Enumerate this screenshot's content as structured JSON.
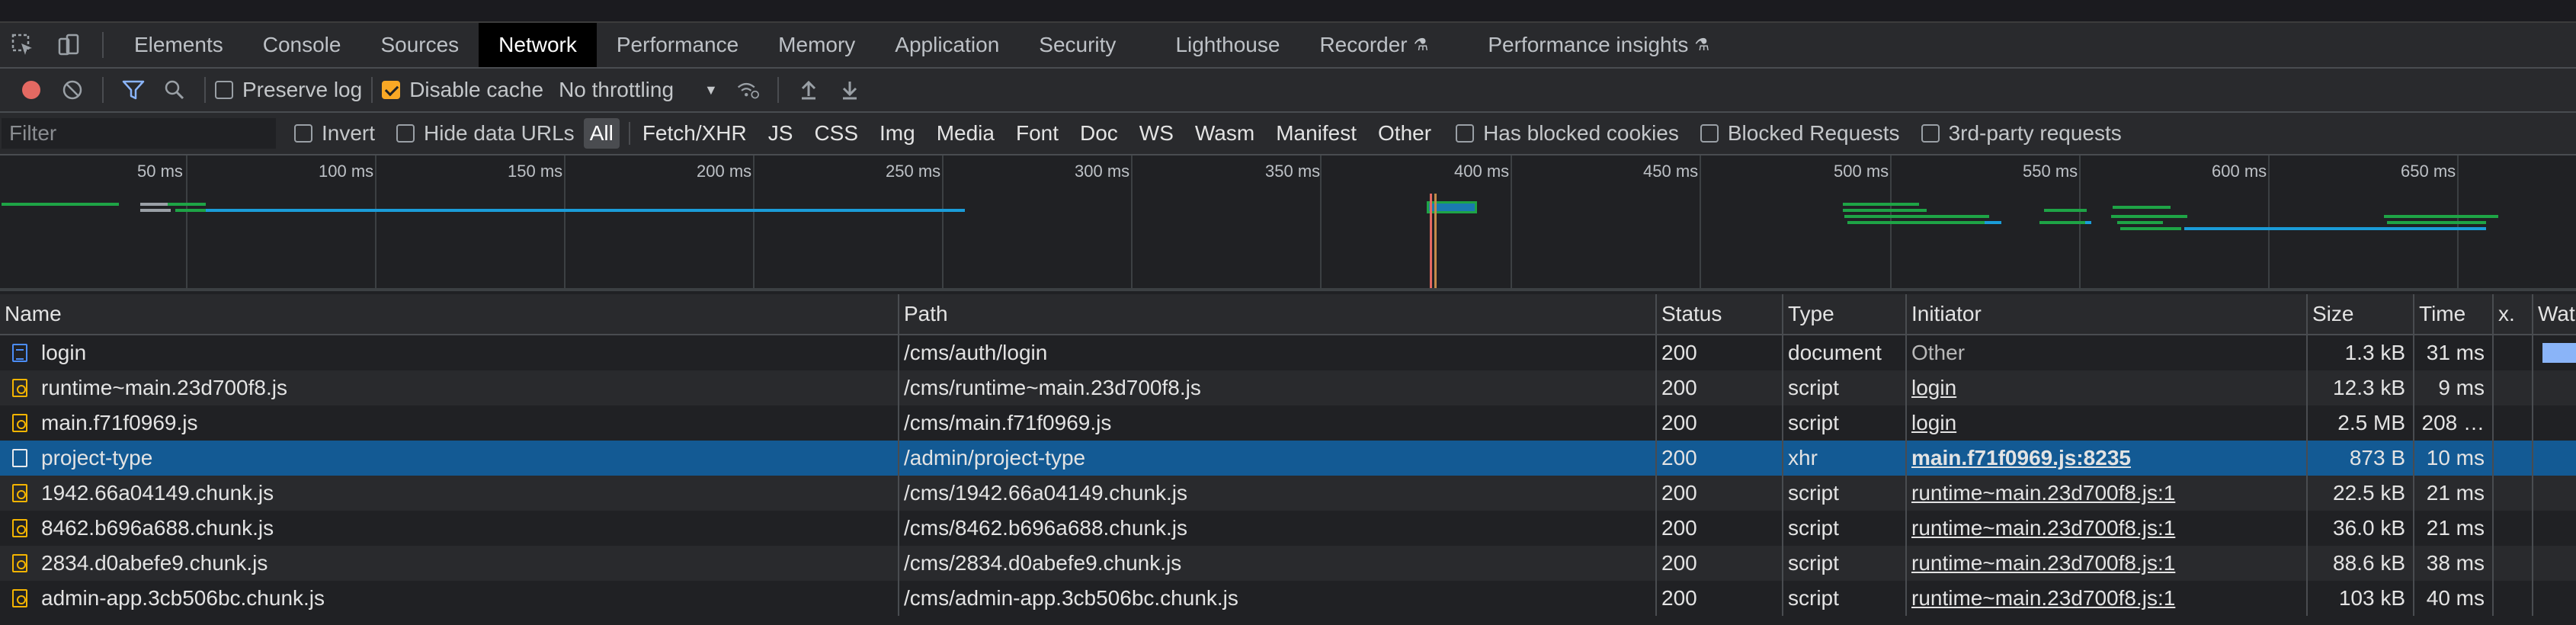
{
  "tabs": [
    {
      "label": "Elements"
    },
    {
      "label": "Console"
    },
    {
      "label": "Sources"
    },
    {
      "label": "Network",
      "active": true
    },
    {
      "label": "Performance"
    },
    {
      "label": "Memory"
    },
    {
      "label": "Application"
    },
    {
      "label": "Security"
    },
    {
      "label": "Lighthouse"
    },
    {
      "label": "Recorder"
    },
    {
      "label": "Performance insights"
    }
  ],
  "toolbar": {
    "preserve_log": "Preserve log",
    "preserve_log_checked": false,
    "disable_cache": "Disable cache",
    "disable_cache_checked": true,
    "throttling": "No throttling"
  },
  "filter": {
    "placeholder": "Filter",
    "invert": "Invert",
    "hide_data_urls": "Hide data URLs",
    "types": [
      "All",
      "Fetch/XHR",
      "JS",
      "CSS",
      "Img",
      "Media",
      "Font",
      "Doc",
      "WS",
      "Wasm",
      "Manifest",
      "Other"
    ],
    "active_type": "All",
    "has_blocked_cookies": "Has blocked cookies",
    "blocked_requests": "Blocked Requests",
    "third_party": "3rd-party requests"
  },
  "overview": {
    "ticks": [
      "50 ms",
      "100 ms",
      "150 ms",
      "200 ms",
      "250 ms",
      "300 ms",
      "350 ms",
      "400 ms",
      "450 ms",
      "500 ms",
      "550 ms",
      "600 ms",
      "650 ms"
    ]
  },
  "table": {
    "columns": {
      "name": "Name",
      "path": "Path",
      "status": "Status",
      "type": "Type",
      "initiator": "Initiator",
      "size": "Size",
      "time": "Time",
      "x": "x.",
      "waterfall": "Wate"
    },
    "rows": [
      {
        "name": "login",
        "icon": "document-icon",
        "path": "/cms/auth/login",
        "status": "200",
        "type": "document",
        "initiator": "Other",
        "initiator_link": false,
        "size": "1.3 kB",
        "time": "31 ms"
      },
      {
        "name": "runtime~main.23d700f8.js",
        "icon": "script-icon",
        "path": "/cms/runtime~main.23d700f8.js",
        "status": "200",
        "type": "script",
        "initiator": "login",
        "initiator_link": true,
        "size": "12.3 kB",
        "time": "9 ms"
      },
      {
        "name": "main.f71f0969.js",
        "icon": "script-icon",
        "path": "/cms/main.f71f0969.js",
        "status": "200",
        "type": "script",
        "initiator": "login",
        "initiator_link": true,
        "size": "2.5 MB",
        "time": "208 …"
      },
      {
        "name": "project-type",
        "icon": "xhr-icon",
        "path": "/admin/project-type",
        "status": "200",
        "type": "xhr",
        "initiator": "main.f71f0969.js:8235",
        "initiator_link": true,
        "size": "873 B",
        "time": "10 ms",
        "selected": true
      },
      {
        "name": "1942.66a04149.chunk.js",
        "icon": "script-icon",
        "path": "/cms/1942.66a04149.chunk.js",
        "status": "200",
        "type": "script",
        "initiator": "runtime~main.23d700f8.js:1",
        "initiator_link": true,
        "size": "22.5 kB",
        "time": "21 ms"
      },
      {
        "name": "8462.b696a688.chunk.js",
        "icon": "script-icon",
        "path": "/cms/8462.b696a688.chunk.js",
        "status": "200",
        "type": "script",
        "initiator": "runtime~main.23d700f8.js:1",
        "initiator_link": true,
        "size": "36.0 kB",
        "time": "21 ms"
      },
      {
        "name": "2834.d0abefe9.chunk.js",
        "icon": "script-icon",
        "path": "/cms/2834.d0abefe9.chunk.js",
        "status": "200",
        "type": "script",
        "initiator": "runtime~main.23d700f8.js:1",
        "initiator_link": true,
        "size": "88.6 kB",
        "time": "38 ms"
      },
      {
        "name": "admin-app.3cb506bc.chunk.js",
        "icon": "script-icon",
        "path": "/cms/admin-app.3cb506bc.chunk.js",
        "status": "200",
        "type": "script",
        "initiator": "runtime~main.23d700f8.js:1",
        "initiator_link": true,
        "size": "103 kB",
        "time": "40 ms"
      }
    ]
  },
  "colors": {
    "accent_blue": "#135a94",
    "record_red": "#e46962",
    "filter_blue": "#8ab4f8",
    "checkbox_orange": "#f9a825",
    "bar_green": "#1ea446",
    "bar_blue": "#1a9cd8"
  }
}
